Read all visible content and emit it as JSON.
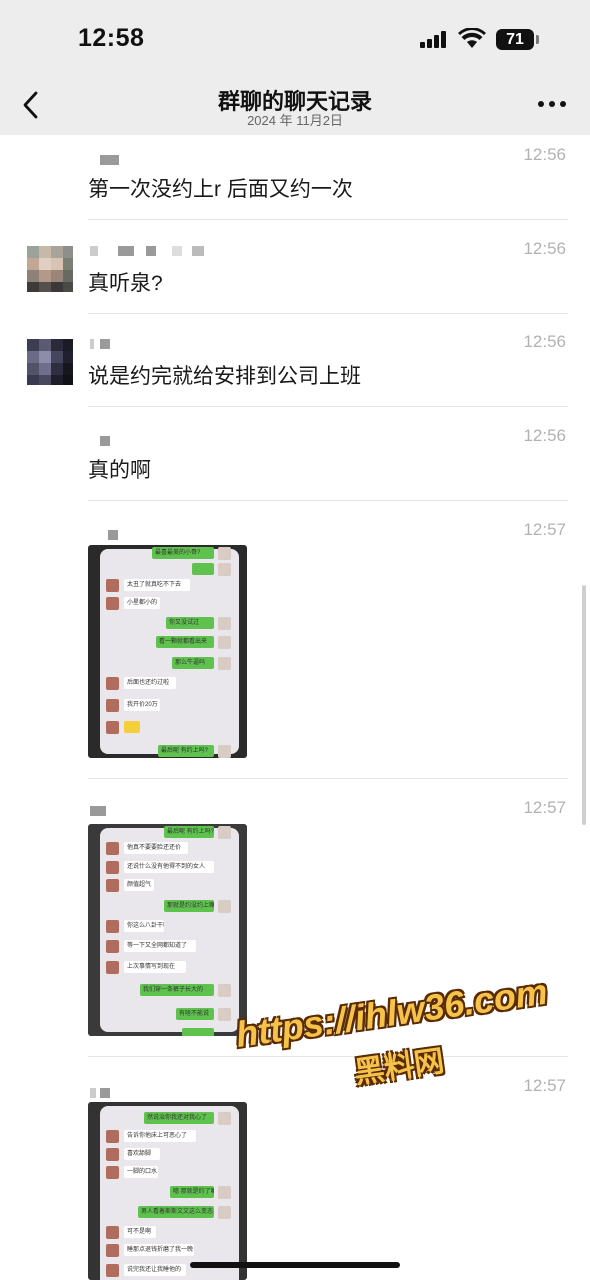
{
  "status_bar": {
    "time": "12:58",
    "battery": "71"
  },
  "nav": {
    "title": "群聊的聊天记录",
    "subtitle": "2024 年 11月2日"
  },
  "messages": [
    {
      "time": "12:56",
      "text": "第一次没约上r 后面又约一次"
    },
    {
      "time": "12:56",
      "text": "真听泉?"
    },
    {
      "time": "12:56",
      "text": "说是约完就给安排到公司上班"
    },
    {
      "time": "12:56",
      "text": "真的啊"
    },
    {
      "time": "12:57"
    },
    {
      "time": "12:57"
    },
    {
      "time": "12:57"
    }
  ],
  "photo1": {
    "b1": "最喜最美的小哥?",
    "b2": "太丑了就真吃不下去",
    "b3": "小星都小的",
    "b4": "你又没试过",
    "b5": "看一颗就都看出来",
    "b6": "那么牛逼吗",
    "b7": "后面也还约过啦",
    "b8": "我开价20万",
    "b9": "最后呢 有约上吗?"
  },
  "photo2": {
    "b1": "最后呢 有约上吗?",
    "b2": "他真不要要脸还还价",
    "b3": "还说什么没有他得不到的女人",
    "b4": "颜值超气",
    "b5": "那就是约没约上嘛",
    "b6": "你这么八卦干嘛",
    "b7": "等一下又全网都知道了",
    "b8": "上次事情写到现在",
    "b9": "我们穿一条裤子长大的",
    "b10": "有啥不能说"
  },
  "photo3": {
    "b1": "然说治你我还对我心了",
    "b2": "告诉你他床上可恶心了",
    "b3": "喜欢舔脚",
    "b4": "一脚的口水",
    "b5": "噫 那就是约了嘛",
    "b6": "男人看着斯斯文文这么变态",
    "b7": "可不是啊",
    "b8": "睡那点退钱折磨了我一晚",
    "b9": "说完我还让我睡他的"
  },
  "watermark": {
    "url": "https://ihlw36.com",
    "name": "黑料网"
  },
  "colors": {
    "nav_bg": "#ededed",
    "bubble_green": "#5fc24f",
    "watermark": "#f5c24a",
    "time_gray": "#b2b2b2"
  }
}
